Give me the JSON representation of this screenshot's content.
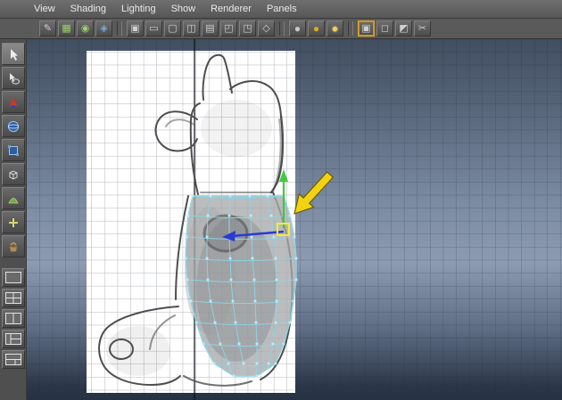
{
  "menubar": {
    "items": [
      "View",
      "Shading",
      "Lighting",
      "Show",
      "Renderer",
      "Panels"
    ]
  },
  "iconbar": {
    "icons": [
      {
        "name": "select-camera-icon",
        "glyph": "✎"
      },
      {
        "name": "grid-snap-icon",
        "glyph": "▦"
      },
      {
        "name": "curve-snap-icon",
        "glyph": "◉"
      },
      {
        "name": "point-snap-icon",
        "glyph": "◈"
      },
      {
        "name": "image-plane-icon",
        "glyph": "▣"
      },
      {
        "name": "film-gate-icon",
        "glyph": "▭"
      },
      {
        "name": "resolution-gate-icon",
        "glyph": "▢"
      },
      {
        "name": "gate-mask-icon",
        "glyph": "◫"
      },
      {
        "name": "field-chart-icon",
        "glyph": "▤"
      },
      {
        "name": "safe-action-icon",
        "glyph": "◰"
      },
      {
        "name": "safe-title-icon",
        "glyph": "◳"
      },
      {
        "name": "wireframe-mode-icon",
        "glyph": "◇"
      },
      {
        "name": "shaded-ball-icon",
        "glyph": "●"
      },
      {
        "name": "textured-ball-icon",
        "glyph": "●"
      },
      {
        "name": "lit-ball-icon",
        "glyph": "●"
      },
      {
        "name": "isolate-select-icon",
        "glyph": "▣"
      },
      {
        "name": "xray-mode-icon",
        "glyph": "◻"
      },
      {
        "name": "wireframe-on-shaded-icon",
        "glyph": "◩"
      },
      {
        "name": "snip-icon",
        "glyph": "✂"
      }
    ]
  },
  "toolbox": {
    "tools": [
      "select-tool",
      "lasso-tool",
      "move-tool",
      "rotate-tool",
      "scale-tool",
      "universal-manipulator-tool",
      "soft-mod-tool",
      "show-manipulator-tool",
      "paint-bucket-tool"
    ],
    "layouts": [
      "layout-single",
      "layout-four-pane",
      "layout-two-pane",
      "layout-persp-outliner",
      "layout-split"
    ]
  },
  "viewport": {
    "colors": {
      "background_top": "#414e60",
      "background_mid": "#8c9bb1",
      "background_bottom": "#263242",
      "grid_line": "#232d3e",
      "image_plane": "#ffffff",
      "sketch_stroke": "#4e4e4e",
      "mesh_fill": "#a6a9ab",
      "wireframe": "#8fd4e6",
      "vertex": "#bfeaf8",
      "manip_y_axis": "#3fca3f",
      "manip_x_axis": "#2b3bd4",
      "manip_center": "#f5ee2e",
      "annotation_arrow": "#f2d313"
    }
  }
}
